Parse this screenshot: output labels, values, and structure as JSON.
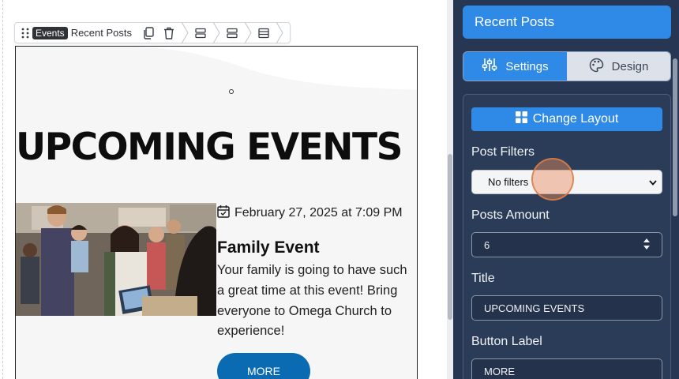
{
  "toolbar": {
    "badge": "Events",
    "label": "Recent Posts"
  },
  "events": {
    "title": "UPCOMING EVENTS",
    "date": "February 27, 2025 at 7:09 PM",
    "name": "Family Event",
    "description": "Your family is going to have such a great time at this event! Bring everyone to Omega Church to experience!",
    "button": "MORE"
  },
  "panel": {
    "header": "Recent Posts",
    "tabs": [
      {
        "label": "Settings",
        "icon": "sliders-icon",
        "active": true
      },
      {
        "label": "Design",
        "icon": "palette-icon",
        "active": false
      }
    ],
    "change_layout": "Change Layout",
    "post_filters": {
      "label": "Post Filters",
      "value": "No filters"
    },
    "posts_amount": {
      "label": "Posts Amount",
      "value": "6"
    },
    "title": {
      "label": "Title",
      "value": "UPCOMING EVENTS"
    },
    "button_label": {
      "label": "Button Label",
      "value": "MORE"
    }
  },
  "colors": {
    "accent": "#2e8ae6",
    "panel_bg": "#273753",
    "more_button": "#0a6bb2"
  }
}
